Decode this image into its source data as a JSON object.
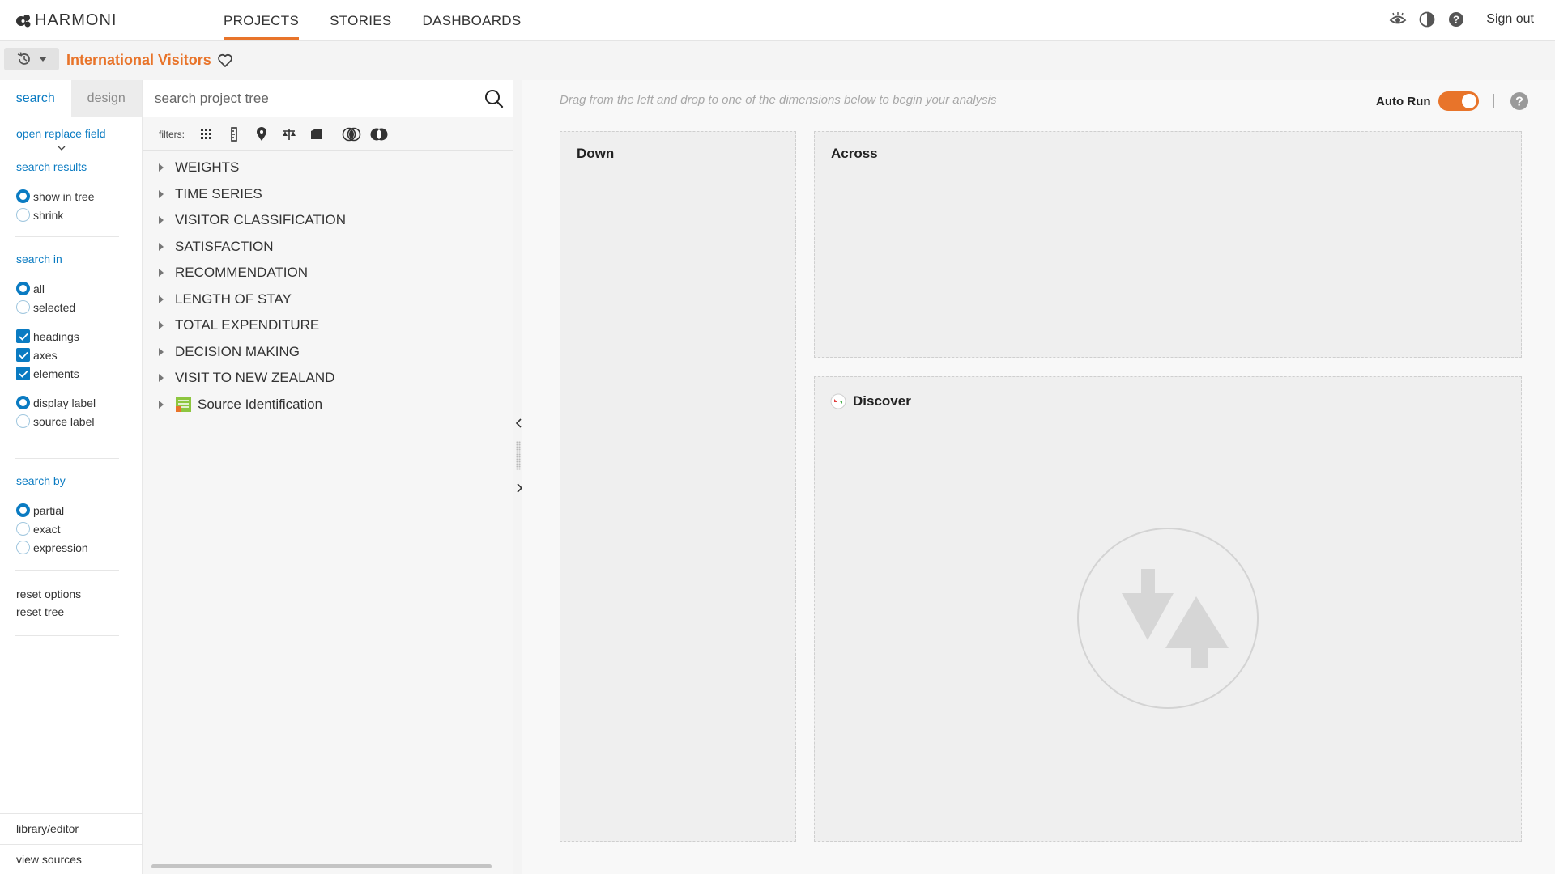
{
  "app": {
    "logo_text": "HARMONI"
  },
  "nav": {
    "items": [
      {
        "label": "PROJECTS",
        "active": true
      },
      {
        "label": "STORIES",
        "active": false
      },
      {
        "label": "DASHBOARDS",
        "active": false
      }
    ],
    "sign_out": "Sign out"
  },
  "project": {
    "title": "International Visitors"
  },
  "options": {
    "tabs": [
      "search",
      "design"
    ],
    "open_replace": "open replace field",
    "search_results": {
      "heading": "search results",
      "choices": [
        "show in tree",
        "shrink"
      ],
      "selected": "show in tree"
    },
    "search_in": {
      "heading": "search in",
      "choices": [
        "all",
        "selected"
      ],
      "selected": "all",
      "checks": [
        "headings",
        "axes",
        "elements"
      ]
    },
    "label_type": {
      "choices": [
        "display label",
        "source label"
      ],
      "selected": "display label"
    },
    "search_by": {
      "heading": "search by",
      "choices": [
        "partial",
        "exact",
        "expression"
      ],
      "selected": "partial"
    },
    "resets": [
      "reset options",
      "reset tree"
    ],
    "footer": [
      "library/editor",
      "view sources"
    ]
  },
  "tree": {
    "search_placeholder": "search project tree",
    "filters_label": "filters:",
    "items": [
      "WEIGHTS",
      "TIME SERIES",
      "VISITOR CLASSIFICATION",
      "SATISFACTION",
      "RECOMMENDATION",
      "LENGTH OF STAY",
      "TOTAL EXPENDITURE",
      "DECISION MAKING",
      "VISIT TO NEW ZEALAND",
      "Source Identification"
    ]
  },
  "workspace": {
    "hint": "Drag from the left and drop to one of the dimensions below to begin your analysis",
    "auto_run_label": "Auto Run",
    "auto_run_on": true,
    "zones": {
      "down": "Down",
      "across": "Across",
      "discover": "Discover"
    }
  },
  "colors": {
    "accent": "#e8742a",
    "link": "#0a7bc2"
  }
}
